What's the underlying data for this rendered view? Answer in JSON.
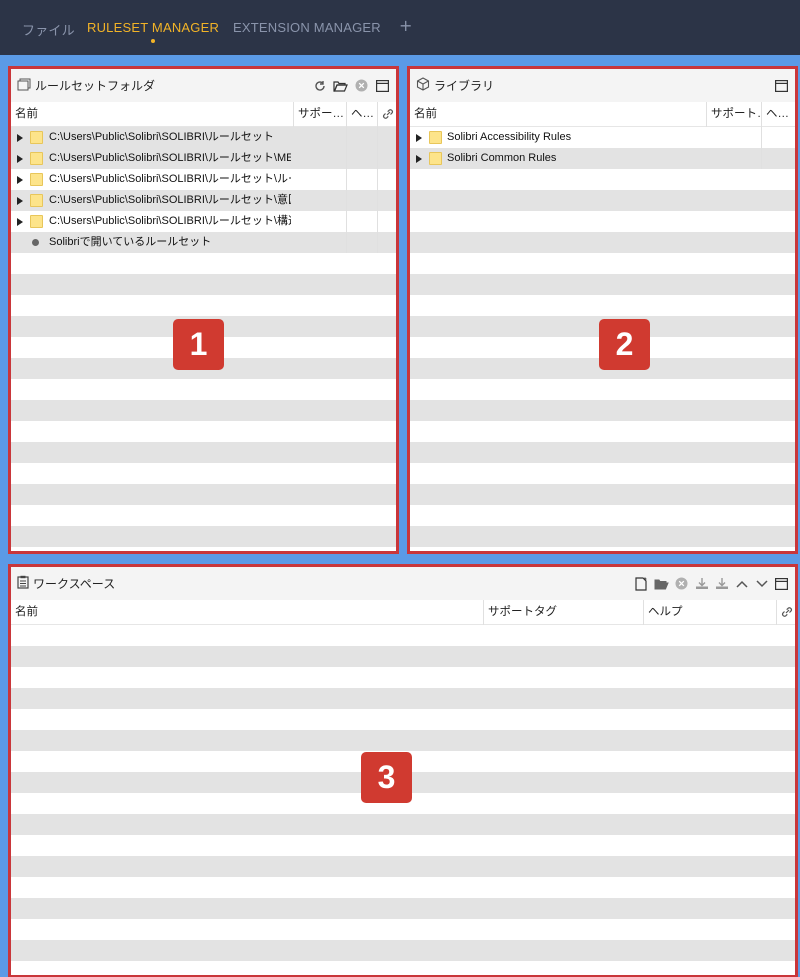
{
  "nav": {
    "tabs": [
      {
        "label": "ファイル",
        "active": false
      },
      {
        "label": "RULESET MANAGER",
        "active": true
      },
      {
        "label": "EXTENSION MANAGER",
        "active": false
      }
    ],
    "add_label": "+"
  },
  "colors": {
    "nav_bg": "#2c3447",
    "accent": "#f2b327",
    "panel_border": "#c9363a",
    "badge": "#d03a30",
    "background": "#5b9ae6"
  },
  "panel1": {
    "title": "ルールセットフォルダ",
    "icons": [
      "refresh-icon",
      "open-folder-icon",
      "remove-icon",
      "maximize-icon"
    ],
    "columns": [
      "名前",
      "サポー…",
      "ヘ…",
      "link-icon"
    ],
    "rows": [
      {
        "label": "C:\\Users\\Public\\Solibri\\SOLIBRI\\ルールセット",
        "type": "folder"
      },
      {
        "label": "C:\\Users\\Public\\Solibri\\SOLIBRI\\ルールセット\\MEP",
        "type": "folder"
      },
      {
        "label": "C:\\Users\\Public\\Solibri\\SOLIBRI\\ルールセット\\ルール",
        "type": "folder"
      },
      {
        "label": "C:\\Users\\Public\\Solibri\\SOLIBRI\\ルールセット\\意匠ル",
        "type": "folder"
      },
      {
        "label": "C:\\Users\\Public\\Solibri\\SOLIBRI\\ルールセット\\構造ル",
        "type": "folder"
      },
      {
        "label": "Solibriで開いているルールセット",
        "type": "bullet"
      }
    ],
    "badge": "1"
  },
  "panel2": {
    "title": "ライブラリ",
    "icons": [
      "maximize-icon"
    ],
    "columns": [
      "名前",
      "サポート…",
      "ヘ…"
    ],
    "rows": [
      {
        "label": "Solibri Accessibility Rules",
        "type": "folder"
      },
      {
        "label": "Solibri Common Rules",
        "type": "folder"
      }
    ],
    "badge": "2"
  },
  "panel3": {
    "title": "ワークスペース",
    "icons": [
      "new-file-icon",
      "open-folder-icon",
      "remove-icon",
      "save-icon",
      "save-as-icon",
      "move-up-icon",
      "move-down-icon",
      "maximize-icon"
    ],
    "columns": [
      "名前",
      "サポートタグ",
      "ヘルプ",
      "link-icon"
    ],
    "rows": [],
    "badge": "3"
  }
}
